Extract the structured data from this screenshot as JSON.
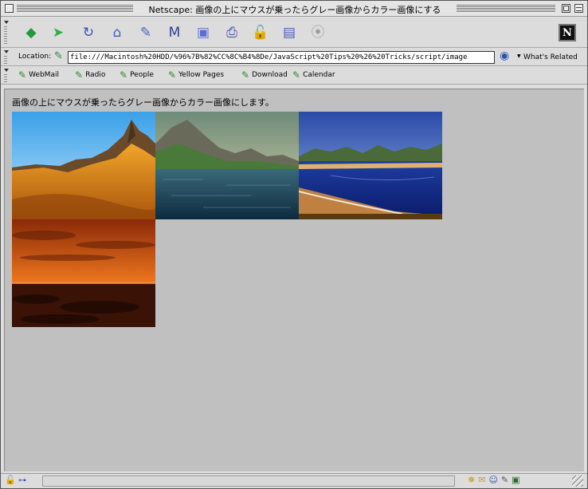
{
  "window": {
    "title": "Netscape: 画像の上にマウスが乗ったらグレー画像からカラー画像にする"
  },
  "nav_toolbar": {
    "buttons": [
      {
        "name": "back-button",
        "icon": "back-arrow-icon",
        "glyph": "◆",
        "color": "#1f9a3a"
      },
      {
        "name": "forward-button",
        "icon": "forward-arrow-icon",
        "glyph": "➤",
        "color": "#2fae4a"
      },
      {
        "name": "reload-button",
        "icon": "reload-icon",
        "glyph": "↻",
        "color": "#3a4fc0"
      },
      {
        "name": "home-button",
        "icon": "home-icon",
        "glyph": "⌂",
        "color": "#3d5bd0"
      },
      {
        "name": "search-button",
        "icon": "search-icon",
        "glyph": "✎",
        "color": "#4b63c8"
      },
      {
        "name": "my-netscape-button",
        "icon": "my-netscape-icon",
        "glyph": "M",
        "color": "#2d3f9e"
      },
      {
        "name": "images-button",
        "icon": "images-icon",
        "glyph": "▣",
        "color": "#5a6fd0"
      },
      {
        "name": "print-button",
        "icon": "print-icon",
        "glyph": "⎙",
        "color": "#3e4fa8"
      },
      {
        "name": "security-button",
        "icon": "lock-icon",
        "glyph": "🔓",
        "color": "#c03030"
      },
      {
        "name": "shop-button",
        "icon": "shop-icon",
        "glyph": "▤",
        "color": "#4a5ac0"
      },
      {
        "name": "stop-button",
        "icon": "stop-icon",
        "glyph": "⦿",
        "color": "#9a9aa6"
      }
    ]
  },
  "location_bar": {
    "label": "Location:",
    "url": "file:///Macintosh%20HDD/%96%7B%82%CC%8C%B4%8De/JavaScript%20Tips%20%26%20Tricks/script/image",
    "whats_related": "What's Related"
  },
  "personal_toolbar": {
    "items": [
      "WebMail",
      "Radio",
      "People",
      "Yellow Pages",
      "Download",
      "Calendar"
    ]
  },
  "content": {
    "text": "画像の上にマウスが乗ったらグレー画像からカラー画像にします。",
    "images": [
      {
        "name": "desert-mountain-image"
      },
      {
        "name": "lake-mountains-image"
      },
      {
        "name": "bay-coast-image"
      },
      {
        "name": "sunset-sea-image"
      }
    ]
  }
}
